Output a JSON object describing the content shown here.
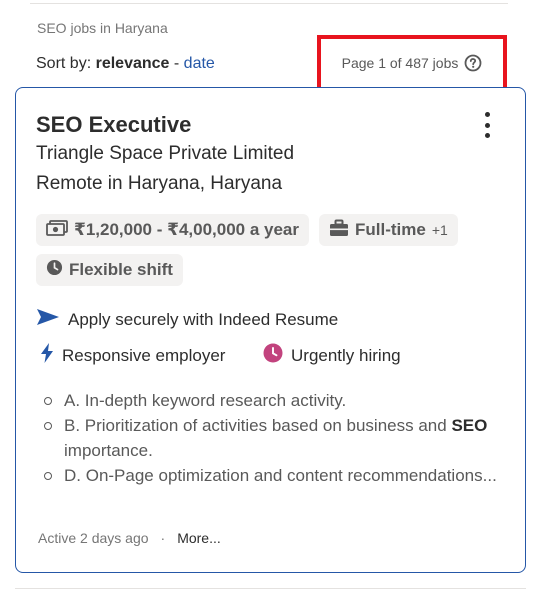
{
  "breadcrumb": "SEO jobs in Haryana",
  "sort": {
    "prefix": "Sort by:",
    "active": "relevance",
    "separator": "-",
    "alternative": "date"
  },
  "page_count": "Page 1 of 487 jobs",
  "job": {
    "title": "SEO Executive",
    "company": "Triangle Space Private Limited",
    "location": "Remote in Haryana, Haryana",
    "salary": "₹1,20,000 - ₹4,00,000 a year",
    "job_type": "Full-time",
    "job_type_extra": "+1",
    "shift": "Flexible shift",
    "apply": "Apply securely with Indeed Resume",
    "responsive": "Responsive employer",
    "urgent": "Urgently hiring",
    "snippet_1": "A. In-depth keyword research activity.",
    "snippet_2_a": "B. Prioritization of activities based on business and ",
    "snippet_2_bold": "SEO",
    "snippet_2_b": " importance.",
    "snippet_3": "D. On-Page optimization and content recommendations...",
    "posted": "Active 2 days ago",
    "dot": "·",
    "more": "More..."
  },
  "colors": {
    "accent": "#2557a7",
    "highlight_box": "#e8141e",
    "urgent": "#c2437e"
  }
}
